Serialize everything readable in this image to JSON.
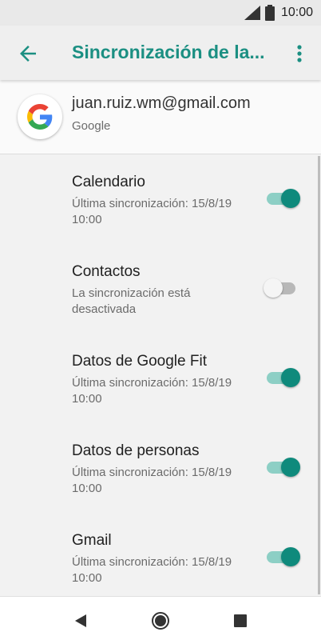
{
  "status_bar": {
    "time": "10:00"
  },
  "app_bar": {
    "title": "Sincronización de la..."
  },
  "account": {
    "email": "juan.ruiz.wm@gmail.com",
    "provider": "Google"
  },
  "sync_items": [
    {
      "title": "Calendario",
      "summary": "Última sincronización: 15/8/19 10:00",
      "enabled": true
    },
    {
      "title": "Contactos",
      "summary": "La sincronización está desactivada",
      "enabled": false
    },
    {
      "title": "Datos de Google Fit",
      "summary": "Última sincronización: 15/8/19 10:00",
      "enabled": true
    },
    {
      "title": "Datos de personas",
      "summary": "Última sincronización: 15/8/19 10:00",
      "enabled": true
    },
    {
      "title": "Gmail",
      "summary": "Última sincronización: 15/8/19 10:00",
      "enabled": true
    }
  ],
  "colors": {
    "accent": "#1b8f82",
    "toggle_on_thumb": "#0f8a7c",
    "toggle_on_track": "#8dcfc5"
  },
  "icons": {
    "back": "arrow-left-icon",
    "menu": "more-vert-icon",
    "signal": "signal-icon",
    "battery": "battery-icon",
    "nav_back": "nav-back-icon",
    "nav_home": "nav-home-icon",
    "nav_recents": "nav-recents-icon",
    "google": "google-logo-icon"
  }
}
